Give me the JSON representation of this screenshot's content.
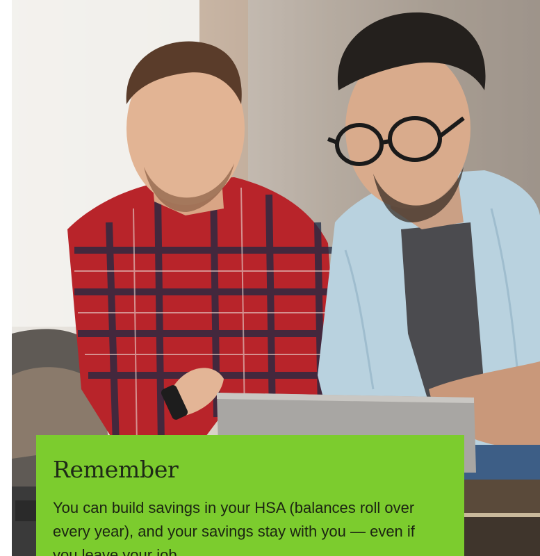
{
  "hero": {
    "image_icon": "photo-two-men-laptop"
  },
  "callout": {
    "title": "Remember",
    "body": "You can build savings in your HSA (balances roll over every year), and your savings stay with you — even if you leave your job.",
    "background_color": "#7ccc2e"
  }
}
